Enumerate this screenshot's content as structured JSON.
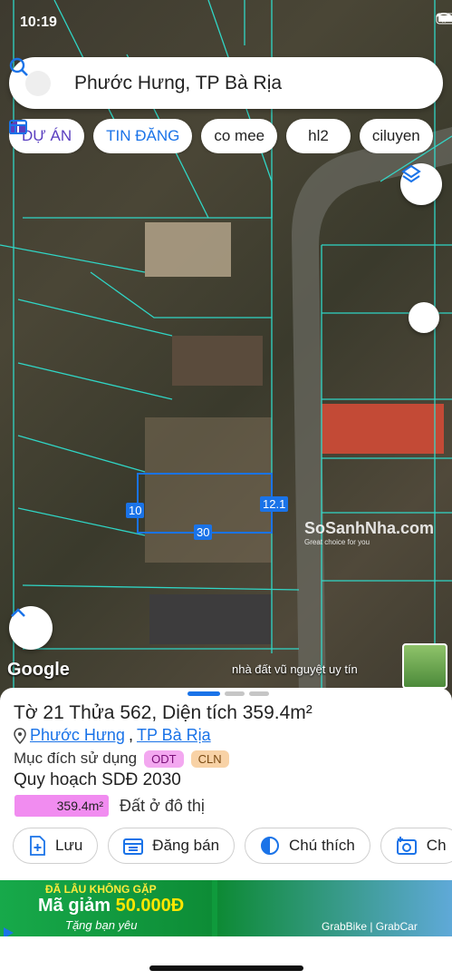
{
  "status": {
    "time": "10:19"
  },
  "search": {
    "query": "Phước Hưng, TP Bà Rịa"
  },
  "chips": [
    {
      "label": "DỰ ÁN",
      "icon": "building-icon"
    },
    {
      "label": "TIN ĐĂNG",
      "icon": "listing-icon"
    },
    {
      "label": "co mee"
    },
    {
      "label": "hl2"
    },
    {
      "label": "ciluyen"
    }
  ],
  "map": {
    "dimensions": {
      "left": "10",
      "right": "12.1",
      "bottom": "30"
    },
    "google_label": "Google",
    "credit": "nhà đất vũ nguyệt uy tín",
    "watermark_brand": "SoSanhNha.com",
    "watermark_tag": "Great choice for you"
  },
  "sheet": {
    "title": "Tờ 21 Thửa 562, Diện tích 359.4m²",
    "ward": "Phước Hưng",
    "city": "TP Bà Rịa",
    "comma": ",",
    "purpose_label": "Mục đích sử dụng",
    "tags": [
      "ODT",
      "CLN"
    ],
    "plan_title": "Quy hoạch SDĐ 2030",
    "area_value": "359.4m²",
    "area_label": "Đất ở đô thị",
    "actions": [
      {
        "label": "Lưu",
        "icon": "add-doc-icon"
      },
      {
        "label": "Đăng bán",
        "icon": "calendar-icon"
      },
      {
        "label": "Chú thích",
        "icon": "legend-icon"
      },
      {
        "label": "Ch",
        "icon": "add-photo-icon"
      }
    ]
  },
  "ad": {
    "headline_small": "ĐÃ LÂU KHÔNG GẶP",
    "headline_prefix": "Mã giảm ",
    "headline_amount": "50.000Đ",
    "subline": "Tặng bạn yêu",
    "brand": "GrabBike | GrabCar"
  },
  "colors": {
    "accent": "#1a73e8",
    "odt": "#f3a8f0",
    "cln": "#f8d2a6",
    "zone": "#f18cf0",
    "parcel_line": "#2ee6d6"
  }
}
